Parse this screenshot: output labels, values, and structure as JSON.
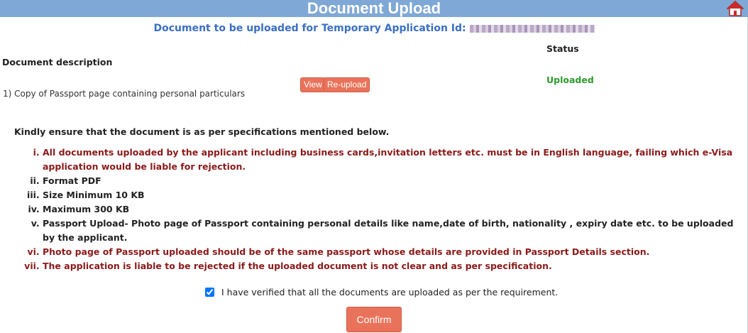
{
  "header": {
    "title": "Document Upload",
    "home_icon": "home-icon"
  },
  "subtitle": {
    "text": "Document to be uploaded for Temporary Application Id:"
  },
  "table": {
    "status_header": "Status",
    "description_header": "Document description",
    "documents": [
      {
        "name": "1) Copy of Passport page containing personal particulars",
        "view_label": "View",
        "reupload_label": "Re-upload",
        "status": "Uploaded"
      }
    ]
  },
  "specs": {
    "notice": "Kindly ensure that the document is as per specifications mentioned below.",
    "items": [
      "All documents uploaded by the applicant including business cards,invitation letters etc. must be in English language, failing which e-Visa application would be liable for rejection.",
      "Format PDF",
      "Size Minimum 10 KB",
      "Maximum 300 KB",
      "Passport Upload- Photo page of Passport containing personal details like name,date of birth, nationality , expiry date etc. to be uploaded by the applicant.",
      "Photo page of Passport uploaded should be of the same passport whose details are provided in Passport Details section.",
      "The application is liable to be rejected if the uploaded document is not clear and as per specification."
    ]
  },
  "verify": {
    "label": "I have verified that all the documents are uploaded as per the requirement.",
    "checked": true
  },
  "confirm_label": "Confirm",
  "colors": {
    "header_bg": "#7fa8d6",
    "subtitle": "#3a6fc4",
    "button": "#e9735a",
    "status_ok": "#2e9b2e",
    "warning_text": "#8b1a1a"
  }
}
